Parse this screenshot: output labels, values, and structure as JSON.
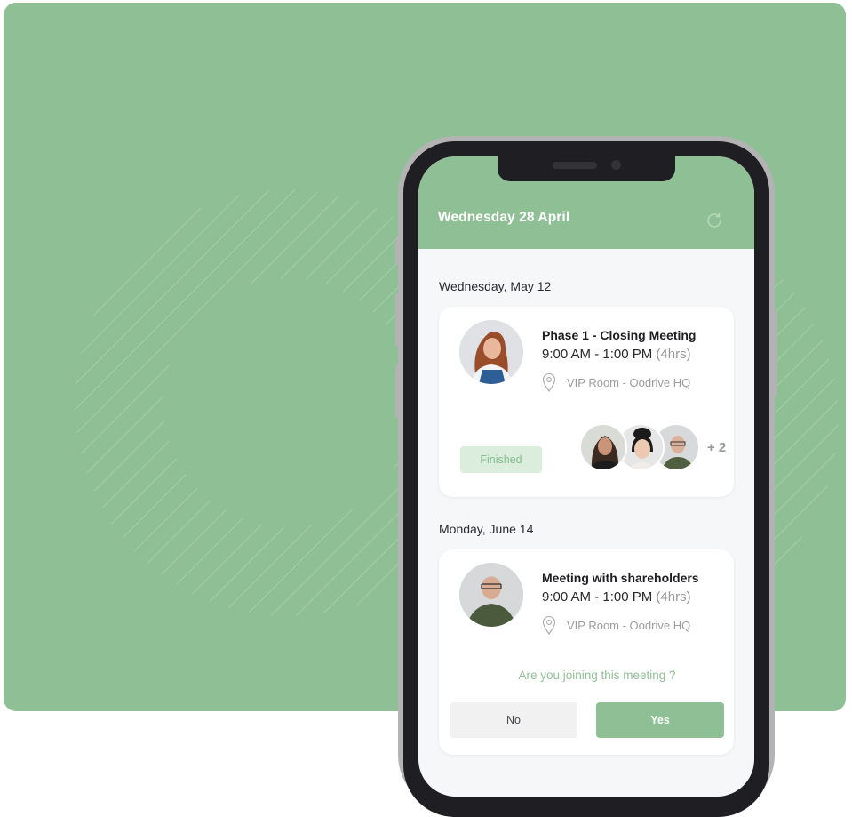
{
  "colors": {
    "brand_green": "#8fbf94",
    "badge_bg": "#dbeedd",
    "phone_bezel": "#1f1e22",
    "screen_bg": "#f6f7f9"
  },
  "app": {
    "header_title": "Wednesday 28 April",
    "refresh_icon": "refresh-icon"
  },
  "days": [
    {
      "label": "Wednesday, May 12",
      "meeting": {
        "title": "Phase 1 - Closing Meeting",
        "time": "9:00 AM - 1:00 PM",
        "duration": "(4hrs)",
        "location": "VIP Room - Oodrive HQ",
        "organizer_avatar": "woman-red-hair-avatar",
        "status": "Finished",
        "attendee_avatars": [
          "woman-dark-hair-avatar",
          "woman-bun-avatar",
          "man-glasses-avatar"
        ],
        "more_attendees": "+ 2"
      }
    },
    {
      "label": "Monday, June 14",
      "meeting": {
        "title": "Meeting with shareholders",
        "time": "9:00 AM - 1:00 PM",
        "duration": "(4hrs)",
        "location": "VIP Room - Oodrive HQ",
        "organizer_avatar": "man-glasses-avatar",
        "question": "Are you joining this meeting ?",
        "no_label": "No",
        "yes_label": "Yes"
      }
    }
  ]
}
